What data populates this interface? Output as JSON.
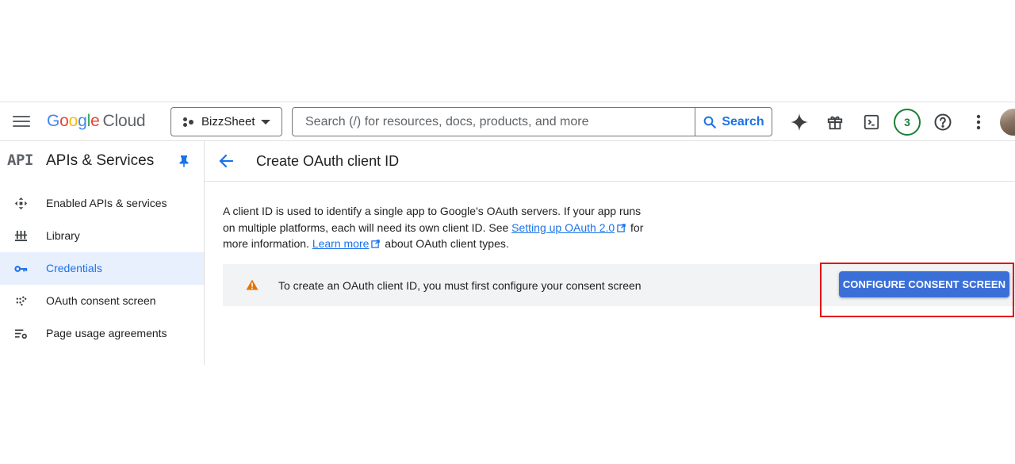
{
  "header": {
    "logo": {
      "word": "Google",
      "suffix": "Cloud"
    },
    "project_name": "BizzSheet",
    "search": {
      "placeholder": "Search (/) for resources, docs, products, and more",
      "button_label": "Search"
    },
    "notification_count": "3",
    "icons": [
      "menu-icon",
      "gemini-icon",
      "gift-icon",
      "cloud-shell-icon",
      "help-icon",
      "more-vert-icon"
    ]
  },
  "sidebar": {
    "logo_text": "API",
    "title": "APIs & Services",
    "items": [
      {
        "label": "Enabled APIs & services",
        "icon": "enabled-apis-icon",
        "active": false
      },
      {
        "label": "Library",
        "icon": "library-icon",
        "active": false
      },
      {
        "label": "Credentials",
        "icon": "key-icon",
        "active": true
      },
      {
        "label": "OAuth consent screen",
        "icon": "consent-icon",
        "active": false
      },
      {
        "label": "Page usage agreements",
        "icon": "agreements-icon",
        "active": false
      }
    ]
  },
  "main": {
    "title": "Create OAuth client ID",
    "description": {
      "part1": "A client ID is used to identify a single app to Google's OAuth servers. If your app runs on multiple platforms, each will need its own client ID. See ",
      "link1": "Setting up OAuth 2.0",
      "part2": " for more information. ",
      "link2": "Learn more",
      "part3": " about OAuth client types."
    },
    "banner": {
      "text": "To create an OAuth client ID, you must first configure your consent screen",
      "button_label": "CONFIGURE CONSENT SCREEN"
    }
  },
  "colors": {
    "accent": "#1a73e8",
    "button": "#3b6fd8",
    "warning": "#e37400",
    "highlight": "#e20f0f",
    "active_bg": "#e8f0fe"
  }
}
